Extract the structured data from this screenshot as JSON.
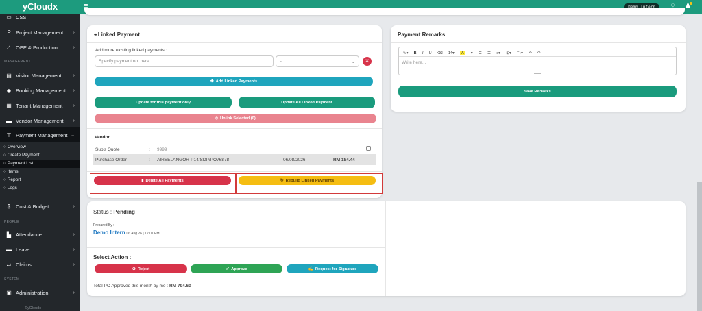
{
  "app": {
    "brand": "yCloudx"
  },
  "topbar": {
    "user_pill": "Demo Intern",
    "menu_icon": "hamburger-icon",
    "bell_icon": "bell-icon",
    "user_icon": "user-icon"
  },
  "sidebar": {
    "items": [
      {
        "label": "CSS",
        "icon": "monitor-icon"
      },
      {
        "label": "Project Management",
        "icon": "p-icon"
      },
      {
        "label": "OEE & Production",
        "icon": "chart-icon"
      },
      {
        "label": "Visitor Management",
        "icon": "id-card-icon"
      },
      {
        "label": "Booking Management",
        "icon": "diamond-icon"
      },
      {
        "label": "Tenant Management",
        "icon": "building-icon"
      },
      {
        "label": "Vendor Management",
        "icon": "vendor-icon"
      },
      {
        "label": "Payment Management",
        "icon": "cart-icon"
      },
      {
        "label": "Cost & Budget",
        "icon": "dollar-icon"
      },
      {
        "label": "Attendance",
        "icon": "attendance-icon"
      },
      {
        "label": "Leave",
        "icon": "leave-icon"
      },
      {
        "label": "Claims",
        "icon": "claims-icon"
      },
      {
        "label": "Administration",
        "icon": "admin-icon"
      }
    ],
    "sections": [
      "MANAGEMENT",
      "PEOPLE",
      "SYSTEM"
    ],
    "sub_items": [
      "Overview",
      "Create Payment",
      "Payment List",
      "Items",
      "Report",
      "Logs"
    ],
    "footer": "©yCloudx"
  },
  "linked_payment": {
    "title": "Linked Payment",
    "add_label": "Add more existing linked payments :",
    "input_placeholder": "Specify payment no. here",
    "select_value": "--",
    "add_button": "Add Linked Payments",
    "update_one_button": "Update for this payment only",
    "update_all_button": "Update All Linked Payment",
    "unlink_button": "Unlink Selected (0)",
    "vendor_label": "Vendor",
    "row1": {
      "label": "Sub's Quote",
      "sep": ":",
      "value": "9999"
    },
    "row2": {
      "label": "Purchase Order",
      "sep": ":",
      "value": "AIRSELANGOR-P14/SDP/PO76878",
      "date": "06/08/2026",
      "amount": "RM 184.44"
    },
    "delete_all_button": "Delete All Payments",
    "rebuild_button": "Rebuild Linked Payments"
  },
  "remarks": {
    "title": "Payment Remarks",
    "placeholder": "Write here...",
    "save_button": "Save Remarks",
    "font_size": "14"
  },
  "status": {
    "label": "Status :",
    "value": "Pending",
    "prepared_by_label": "Prepared By :",
    "prepared_by_name": "Demo Intern",
    "prepared_by_date": "06 Aug 26 | 12:01 PM",
    "select_action": "Select Action :",
    "reject_button": "Reject",
    "approve_button": "Approve",
    "signature_button": "Request for Signature",
    "total_label": "Total PO Approved this month by me :",
    "total_value": "RM 794.60"
  },
  "colors": {
    "brand": "#1d9b7e",
    "sidebar": "#23272b",
    "danger": "#d7334a",
    "warning": "#f5bd12",
    "info": "#1fa5bd"
  }
}
